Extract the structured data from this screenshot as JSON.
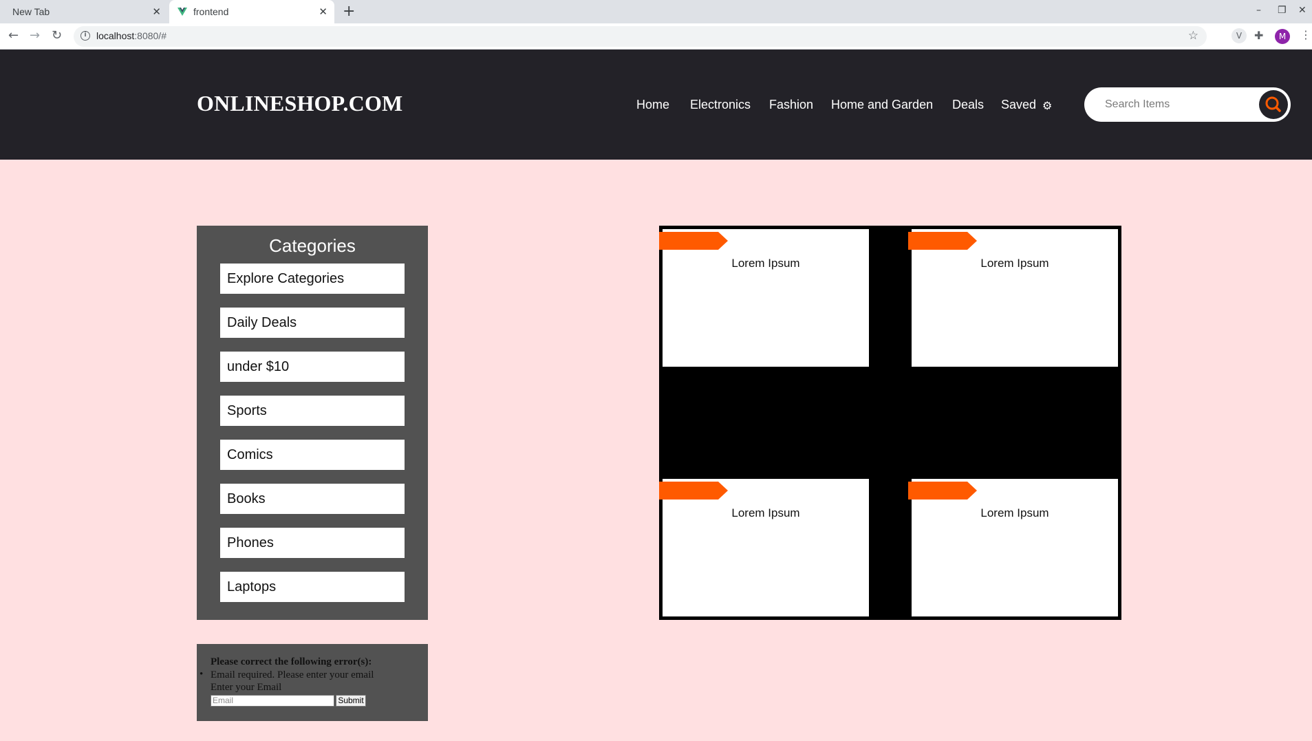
{
  "browser": {
    "tabs": [
      {
        "label": "New Tab",
        "active": false
      },
      {
        "label": "frontend",
        "active": true
      }
    ],
    "url_host": "localhost",
    "url_rest": ":8080/#",
    "avatar_letter": "M"
  },
  "header": {
    "logo": "ONLINESHOP.COM",
    "nav": [
      "Home",
      "Electronics",
      "Fashion",
      "Home and Garden",
      "Deals",
      "Saved"
    ],
    "search_placeholder": "Search Items",
    "colors": {
      "header_bg": "#232228",
      "accent": "#ff5a00",
      "page_bg": "#ffe0e1"
    }
  },
  "categories": {
    "title": "Categories",
    "items": [
      "Explore Categories",
      "Daily Deals",
      "under $10",
      "Sports",
      "Comics",
      "Books",
      "Phones",
      "Laptops"
    ]
  },
  "newsletter": {
    "error_heading": "Please correct the following error(s):",
    "error_item": "Email required. Please enter your email",
    "prompt": "Enter your Email",
    "email_placeholder": "Email",
    "submit_label": "Submit"
  },
  "products": [
    {
      "label": "Lorem Ipsum"
    },
    {
      "label": "Lorem Ipsum"
    },
    {
      "label": "Lorem Ipsum"
    },
    {
      "label": "Lorem Ipsum"
    }
  ]
}
